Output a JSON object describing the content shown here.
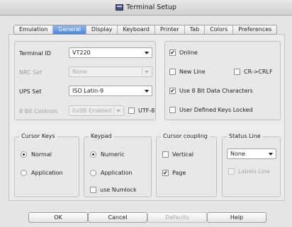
{
  "window": {
    "title": "Terminal Setup",
    "icon": "terminal-window-icon"
  },
  "tabs": [
    {
      "label": "Emulation",
      "active": false
    },
    {
      "label": "General",
      "active": true
    },
    {
      "label": "Display",
      "active": false
    },
    {
      "label": "Keyboard",
      "active": false
    },
    {
      "label": "Printer",
      "active": false
    },
    {
      "label": "Tab",
      "active": false
    },
    {
      "label": "Colors",
      "active": false
    },
    {
      "label": "Preferences",
      "active": false
    }
  ],
  "general": {
    "terminal_id": {
      "label": "Terminal ID",
      "value": "VT220"
    },
    "nrc_set": {
      "label": "NRC Set",
      "value": "None"
    },
    "ups_set": {
      "label": "UPS Set",
      "value": "ISO Latin-9"
    },
    "bit_controls": {
      "label": "8 Bit Controls",
      "value": "0x9B Enabled"
    },
    "utf8": {
      "label": "UTF-8",
      "checked": false
    }
  },
  "options": {
    "online": {
      "label": "Online",
      "checked": true
    },
    "new_line": {
      "label": "New Line",
      "checked": false
    },
    "cr_crlf": {
      "label": "CR->CRLF",
      "checked": false
    },
    "use_8bit": {
      "label": "Use 8 Bit Data Characters",
      "checked": true
    },
    "udk_locked": {
      "label": "User Defined Keys Locked",
      "checked": false
    }
  },
  "cursor_keys": {
    "title": "Cursor Keys",
    "normal": {
      "label": "Normal",
      "selected": true
    },
    "application": {
      "label": "Application",
      "selected": false
    }
  },
  "keypad": {
    "title": "Keypad",
    "numeric": {
      "label": "Numeric",
      "selected": true
    },
    "application": {
      "label": "Application",
      "selected": false
    },
    "use_numlock": {
      "label": "use Numlock",
      "checked": false
    }
  },
  "cursor_coupling": {
    "title": "Cursor coupling",
    "vertical": {
      "label": "Vertical",
      "checked": false
    },
    "page": {
      "label": "Page",
      "checked": true
    }
  },
  "status_line": {
    "title": "Status Line",
    "value": "None",
    "labels_line": {
      "label": "Labels Line",
      "checked": false
    }
  },
  "buttons": {
    "ok": "OK",
    "cancel": "Cancel",
    "defaults": "Defaults",
    "help": "Help"
  },
  "glyphs": {
    "check": "✔"
  },
  "colors": {
    "accent": "#4a86dc"
  }
}
